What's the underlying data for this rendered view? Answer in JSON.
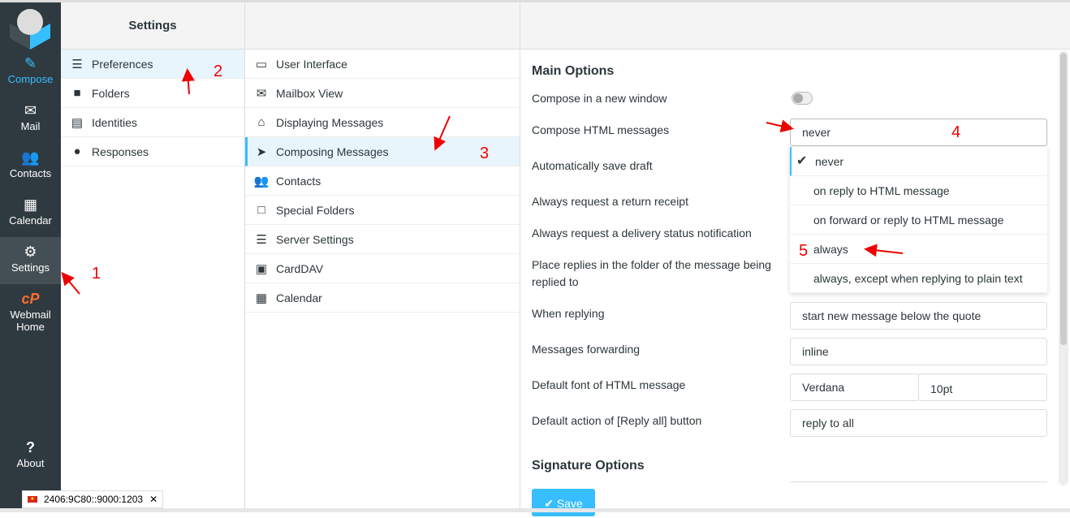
{
  "sidebar": {
    "items": [
      {
        "label": "Compose",
        "icon": "compose-icon"
      },
      {
        "label": "Mail",
        "icon": "envelope-icon"
      },
      {
        "label": "Contacts",
        "icon": "users-icon"
      },
      {
        "label": "Calendar",
        "icon": "calendar-icon"
      },
      {
        "label": "Settings",
        "icon": "gear-icon"
      },
      {
        "label": "Webmail Home",
        "icon": "cpanel-icon"
      },
      {
        "label": "About",
        "icon": "question-icon"
      }
    ]
  },
  "settings": {
    "title": "Settings",
    "items": [
      "Preferences",
      "Folders",
      "Identities",
      "Responses"
    ]
  },
  "sections": [
    "User Interface",
    "Mailbox View",
    "Displaying Messages",
    "Composing Messages",
    "Contacts",
    "Special Folders",
    "Server Settings",
    "CardDAV",
    "Calendar"
  ],
  "main": {
    "heading": "Main Options",
    "labels": [
      "Compose in a new window",
      "Compose HTML messages",
      "Automatically save draft",
      "Always request a return receipt",
      "Always request a delivery status notification",
      "Place replies in the folder of the message being replied to",
      "When replying",
      "Messages forwarding",
      "Default font of HTML message",
      "Default action of [Reply all] button"
    ],
    "compose_html_value": "never",
    "dropdown_options": [
      "never",
      "on reply to HTML message",
      "on forward or reply to HTML message",
      "always",
      "always, except when replying to plain text"
    ],
    "when_replying": "start new message below the quote",
    "forwarding": "inline",
    "font": "Verdana",
    "font_size": "10pt",
    "reply_all": "reply to all",
    "signature_heading": "Signature Options",
    "save_label": "Save",
    "compose_new_window": false
  },
  "status": {
    "ip": "2406:9C80::9000:1203"
  },
  "annotations": [
    "1",
    "2",
    "3",
    "4",
    "5"
  ],
  "colors": {
    "accent": "#37beff",
    "sidebar": "#2f3a40",
    "annotation": "#ee0000"
  }
}
